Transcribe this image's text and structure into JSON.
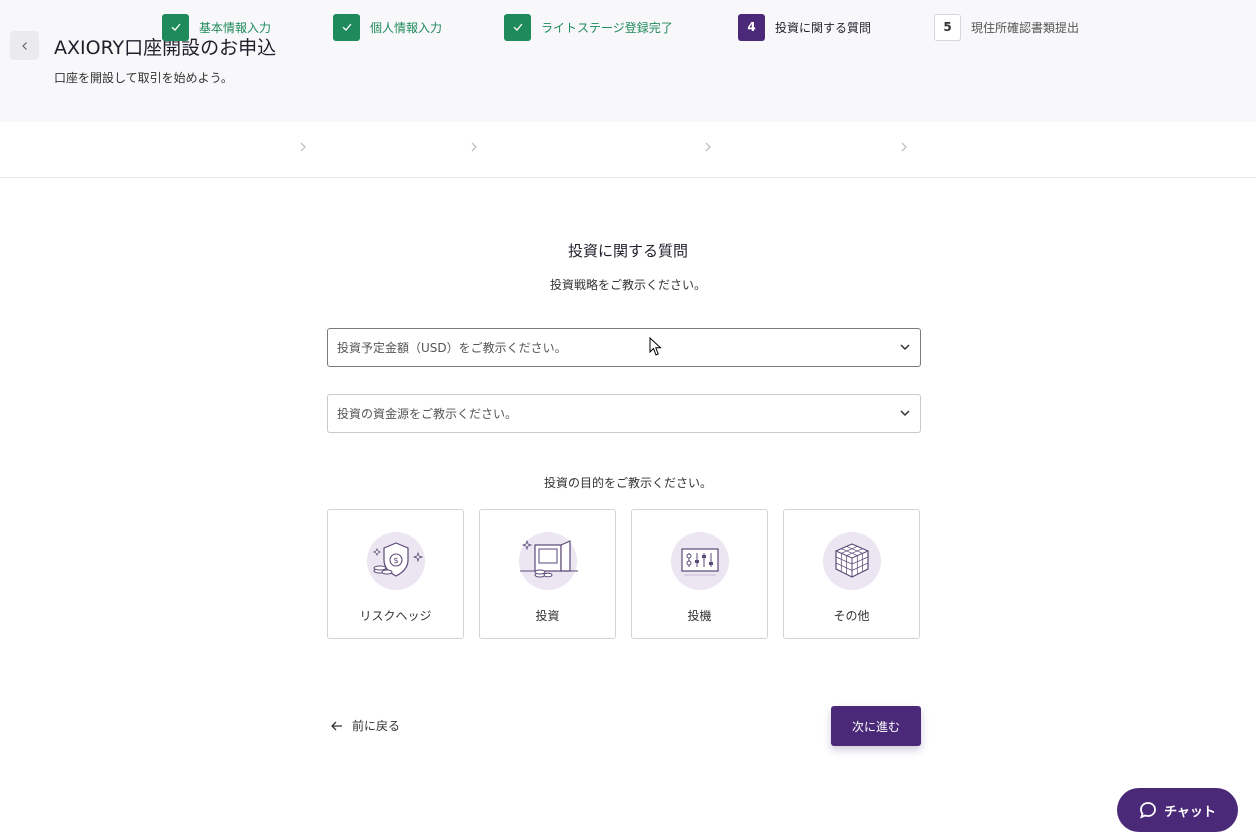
{
  "header": {
    "title": "AXIORY口座開設のお申込",
    "subtitle": "口座を開設して取引を始めよう。"
  },
  "stepper": {
    "steps": [
      {
        "number": "",
        "label": "基本情報入力",
        "state": "done"
      },
      {
        "number": "",
        "label": "個人情報入力",
        "state": "done"
      },
      {
        "number": "",
        "label": "ライトステージ登録完了",
        "state": "done"
      },
      {
        "number": "4",
        "label": "投資に関する質問",
        "state": "active"
      },
      {
        "number": "5",
        "label": "現住所確認書類提出",
        "state": "todo"
      }
    ]
  },
  "form": {
    "title": "投資に関する質問",
    "description": "投資戦略をご教示ください。",
    "amount_select": {
      "placeholder": "投資予定金額（USD）をご教示ください。"
    },
    "source_select": {
      "placeholder": "投資の資金源をご教示ください。"
    },
    "purpose_label": "投資の目的をご教示ください。",
    "purposes": [
      {
        "label": "リスクヘッジ",
        "icon": "shield-dollar-icon"
      },
      {
        "label": "投資",
        "icon": "safe-icon"
      },
      {
        "label": "投機",
        "icon": "sliders-panel-icon"
      },
      {
        "label": "その他",
        "icon": "cube-grid-icon"
      }
    ]
  },
  "nav": {
    "prev_label": "前に戻る",
    "next_label": "次に進む"
  },
  "chat": {
    "label": "チャット"
  },
  "colors": {
    "primary": "#4a2a78",
    "done": "#1f8a5b",
    "icon_bg": "#ece6f3"
  }
}
